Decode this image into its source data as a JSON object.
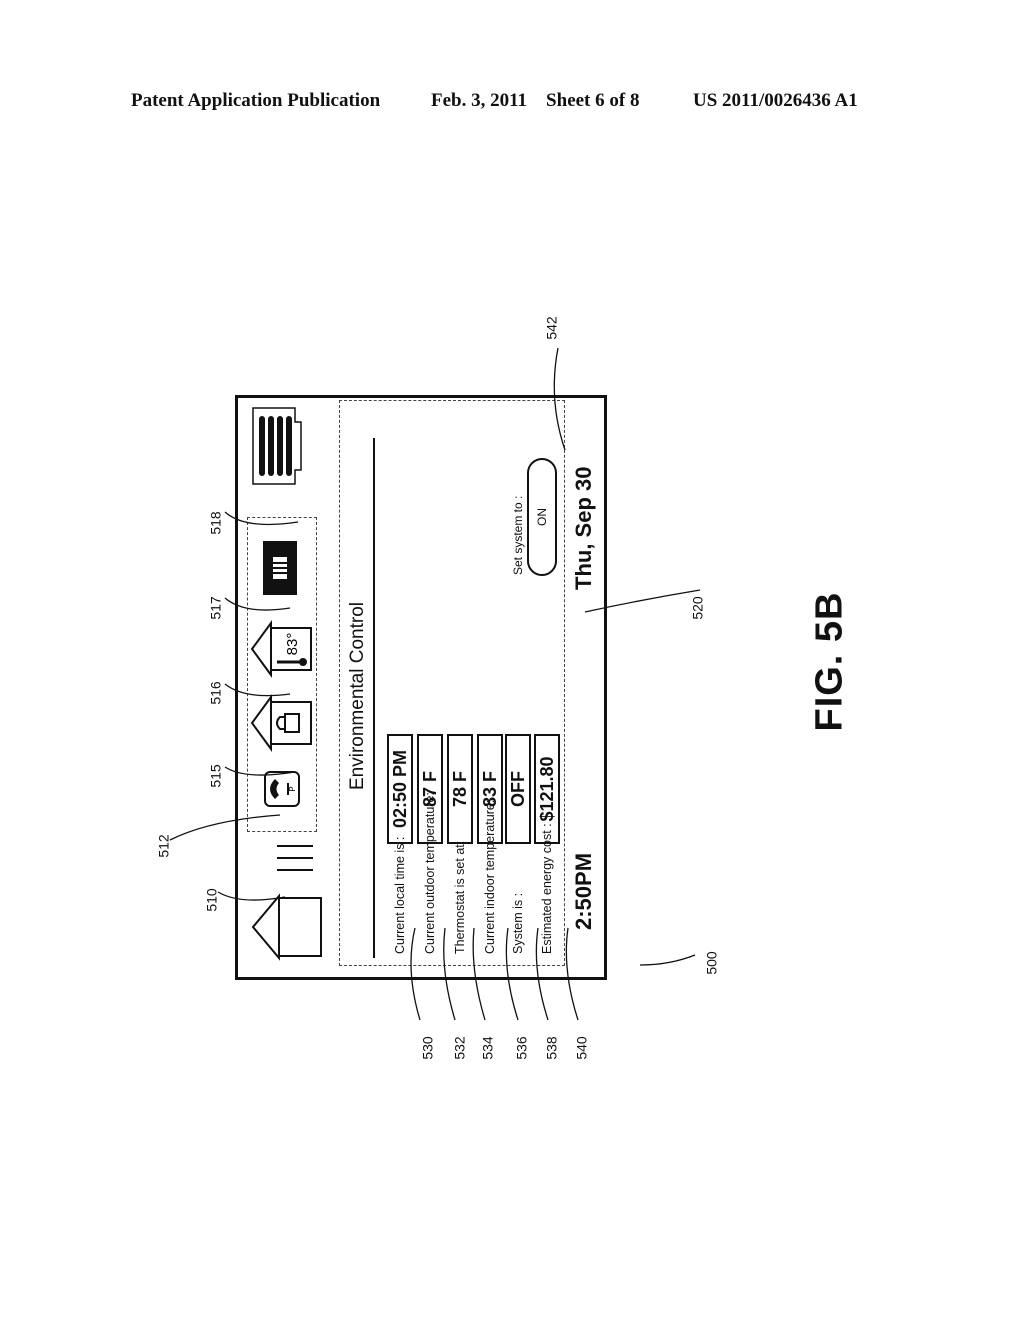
{
  "header": {
    "publication": "Patent Application Publication",
    "date_sheet": "Feb. 3, 2011    Sheet 6 of 8",
    "number": "US 2011/0026436 A1"
  },
  "figure": {
    "label": "FIG. 5B",
    "orientation": "rotated 90 degrees counter-clockwise",
    "screen": {
      "title": "Environmental Control",
      "rows": [
        {
          "label": "Current local time is :",
          "value": "02:50 PM"
        },
        {
          "label": "Current outdoor temperature:",
          "value": "87 F"
        },
        {
          "label": "Thermostat is set at:",
          "value": "78 F"
        },
        {
          "label": "Current indoor temperature:",
          "value": "83 F"
        },
        {
          "label": "System is :",
          "value": "OFF"
        },
        {
          "label": "Estimated energy cost :",
          "value": "$121.80"
        }
      ],
      "set_system_label": "Set system to :",
      "set_system_button": "ON",
      "time": "2:50PM",
      "date": "Thu, Sep 30",
      "thermometer_icon_value": "83°"
    },
    "icons": [
      {
        "name": "home-icon",
        "ref": "510"
      },
      {
        "name": "phone-icon",
        "ref": "515"
      },
      {
        "name": "lock-icon",
        "ref": "516"
      },
      {
        "name": "thermometer-icon",
        "ref": "517"
      },
      {
        "name": "media-icon",
        "ref": "518"
      },
      {
        "name": "menu-bars-icon",
        "ref": ""
      }
    ],
    "reference_numerals": {
      "device": "500",
      "home": "510",
      "icon_bar": "512",
      "phone": "515",
      "lock": "516",
      "thermometer": "517",
      "media": "518",
      "panel": "520",
      "local_time": "530",
      "outdoor_temp": "532",
      "thermostat": "534",
      "indoor_temp": "536",
      "system": "538",
      "energy_cost": "540",
      "set_system": "542"
    }
  }
}
